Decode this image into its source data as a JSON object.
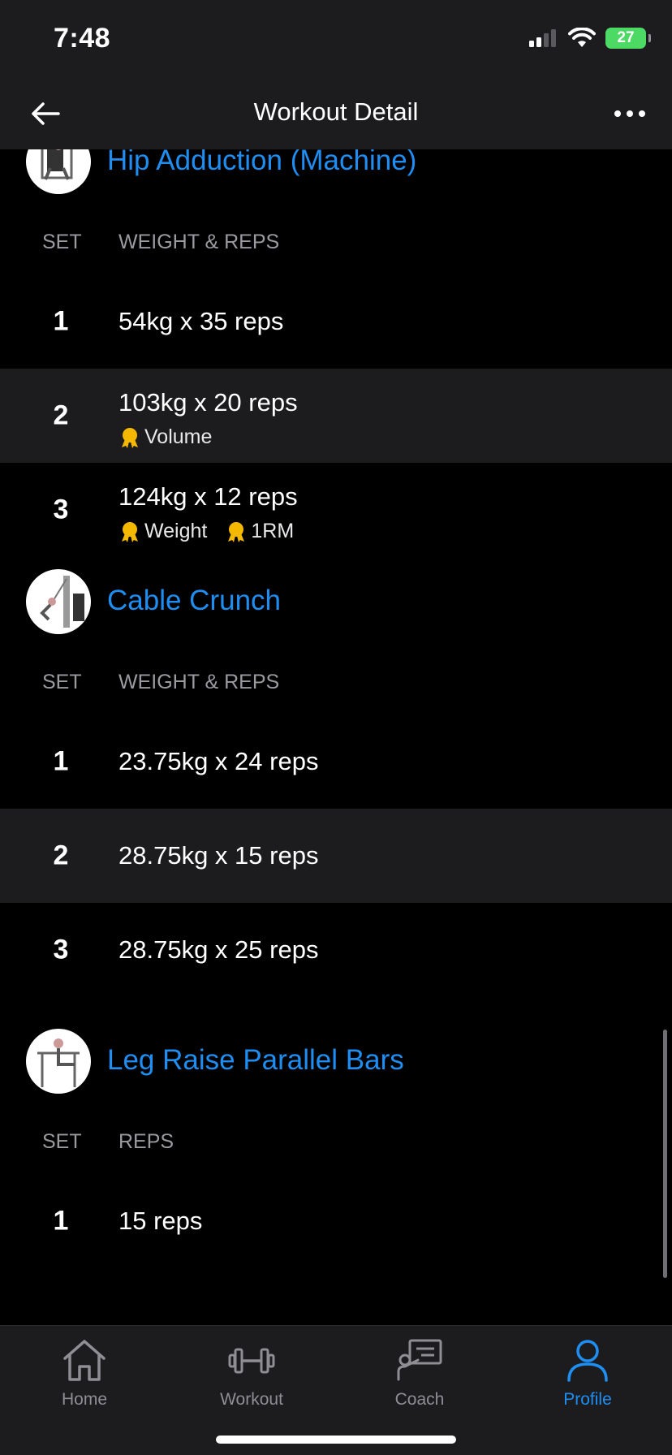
{
  "status_bar": {
    "time": "7:48",
    "battery": "27"
  },
  "nav": {
    "title": "Workout Detail"
  },
  "exercises": [
    {
      "name": "Hip Adduction (Machine)",
      "col_set": "SET",
      "col_values": "WEIGHT & REPS",
      "sets": [
        {
          "num": "1",
          "value": "54kg x 35 reps",
          "prs": []
        },
        {
          "num": "2",
          "value": "103kg x 20 reps",
          "prs": [
            "Volume"
          ]
        },
        {
          "num": "3",
          "value": "124kg x 12 reps",
          "prs": [
            "Weight",
            "1RM"
          ]
        }
      ]
    },
    {
      "name": "Cable Crunch",
      "col_set": "SET",
      "col_values": "WEIGHT & REPS",
      "sets": [
        {
          "num": "1",
          "value": "23.75kg x 24 reps"
        },
        {
          "num": "2",
          "value": "28.75kg x 15 reps"
        },
        {
          "num": "3",
          "value": "28.75kg x 25 reps"
        }
      ]
    },
    {
      "name": "Leg Raise Parallel Bars",
      "col_set": "SET",
      "col_values": "REPS",
      "sets": [
        {
          "num": "1",
          "value": "15 reps"
        }
      ]
    }
  ],
  "tabs": [
    {
      "label": "Home",
      "icon": "home-icon"
    },
    {
      "label": "Workout",
      "icon": "dumbbell-icon"
    },
    {
      "label": "Coach",
      "icon": "coach-icon"
    },
    {
      "label": "Profile",
      "icon": "profile-icon"
    }
  ],
  "colors": {
    "accent": "#1e8ef3",
    "medal": "#f5b800",
    "background": "#000000",
    "surface": "#1c1c1e"
  }
}
